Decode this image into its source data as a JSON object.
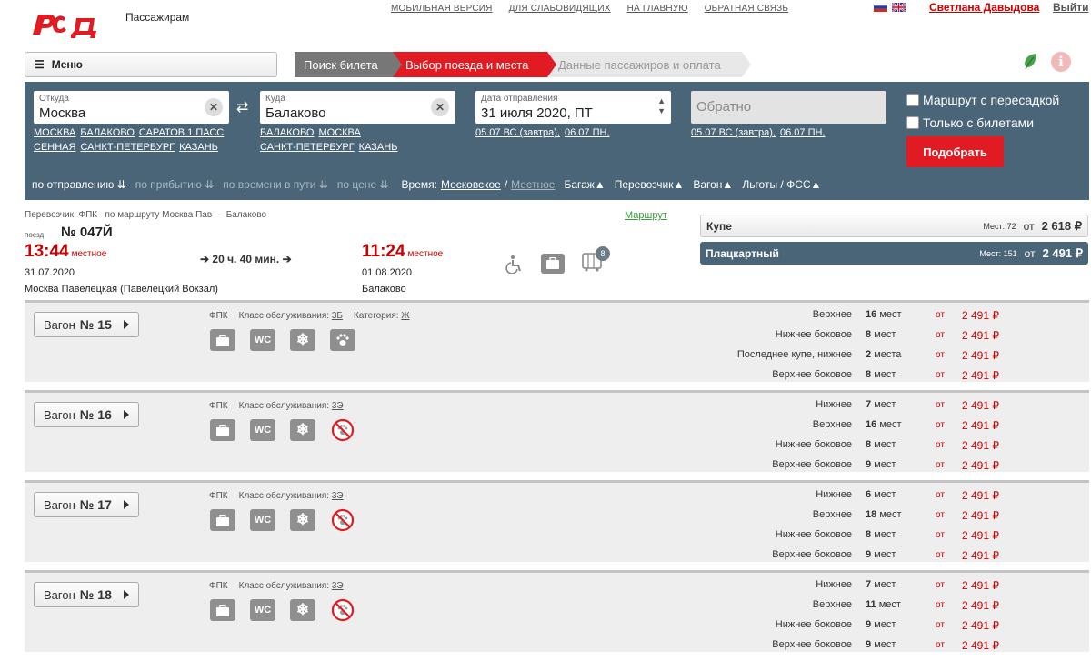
{
  "header": {
    "logo_alt": "РЖД",
    "subtitle": "Пассажирам",
    "links": [
      "МОБИЛЬНАЯ ВЕРСИЯ",
      "ДЛЯ СЛАБОВИДЯЩИХ",
      "НА ГЛАВНУЮ",
      "ОБРАТНАЯ СВЯЗЬ"
    ],
    "user": "Светлана Давыдова",
    "logout": "Выйти"
  },
  "menu": {
    "label": "Меню"
  },
  "steps": [
    "Поиск билета",
    "Выбор поезда и места",
    "Данные пассажиров и оплата"
  ],
  "search": {
    "from": {
      "label": "Откуда",
      "value": "Москва",
      "quick": [
        "МОСКВА",
        "БАЛАКОВО",
        "САРАТОВ 1 ПАСС",
        "СЕННАЯ",
        "САНКТ-ПЕТЕРБУРГ",
        "КАЗАНЬ"
      ]
    },
    "to": {
      "label": "Куда",
      "value": "Балаково",
      "quick": [
        "БАЛАКОВО",
        "МОСКВА",
        "САНКТ-ПЕТЕРБУРГ",
        "КАЗАНЬ"
      ]
    },
    "date": {
      "label": "Дата отправления",
      "value": "31 июля 2020, ПТ",
      "quick": [
        "05.07 ВС (завтра),",
        "06.07 ПН,"
      ]
    },
    "back": {
      "placeholder": "Обратно",
      "quick": [
        "05.07 ВС (завтра),",
        "06.07 ПН,"
      ]
    },
    "transfer_label": "Маршрут с пересадкой",
    "tickets_only_label": "Только с билетами",
    "find_button": "Подобрать"
  },
  "sort": {
    "by_departure": "по отправлению",
    "by_arrival": "по прибытию",
    "by_duration": "по времени в пути",
    "by_price": "по цене",
    "time_label": "Время:",
    "time_moscow": "Московское",
    "time_sep": "/",
    "time_local": "Местное",
    "baggage": "Багаж",
    "carrier": "Перевозчик",
    "car": "Вагон",
    "benefits": "Льготы / ФСС"
  },
  "train": {
    "carrier": "Перевозчик: ФПК",
    "route": "по маршруту Москва Пав — Балаково",
    "route_link": "Маршрут",
    "num_label": "поезд",
    "number": "№ 047Й",
    "dep_time": "13:44",
    "dep_type": "местное",
    "dep_date": "31.07.2020",
    "dep_station": "Москва Павелецкая (Павелецкий Вокзал)",
    "duration": "20 ч. 40 мин.",
    "arr_time": "11:24",
    "arr_type": "местное",
    "arr_date": "01.08.2020",
    "arr_station": "Балаково",
    "cars_badge": "8"
  },
  "classes": [
    {
      "name": "Купе",
      "seats": "Мест: 72",
      "from": "от",
      "price": "2 618 ₽"
    },
    {
      "name": "Плацкартный",
      "seats": "Мест: 151",
      "from": "от",
      "price": "2 491 ₽"
    }
  ],
  "cars": [
    {
      "label": "Вагон",
      "num": "№ 15",
      "carrier": "ФПК",
      "class_label": "Класс обслуживания:",
      "class": "3Б",
      "cat_label": "Категория:",
      "cat": "Ж",
      "pets": true,
      "seats": [
        {
          "type": "Верхнее",
          "count": "16",
          "unit": "мест",
          "from": "от",
          "price": "2 491 ₽"
        },
        {
          "type": "Нижнее боковое",
          "count": "8",
          "unit": "мест",
          "from": "от",
          "price": "2 491 ₽"
        },
        {
          "type": "Последнее купе, нижнее",
          "count": "2",
          "unit": "места",
          "from": "от",
          "price": "2 491 ₽"
        },
        {
          "type": "Верхнее боковое",
          "count": "8",
          "unit": "мест",
          "from": "от",
          "price": "2 491 ₽"
        }
      ]
    },
    {
      "label": "Вагон",
      "num": "№ 16",
      "carrier": "ФПК",
      "class_label": "Класс обслуживания:",
      "class": "3Э",
      "pets": false,
      "seats": [
        {
          "type": "Нижнее",
          "count": "7",
          "unit": "мест",
          "from": "от",
          "price": "2 491 ₽"
        },
        {
          "type": "Верхнее",
          "count": "16",
          "unit": "мест",
          "from": "от",
          "price": "2 491 ₽"
        },
        {
          "type": "Нижнее боковое",
          "count": "8",
          "unit": "мест",
          "from": "от",
          "price": "2 491 ₽"
        },
        {
          "type": "Верхнее боковое",
          "count": "9",
          "unit": "мест",
          "from": "от",
          "price": "2 491 ₽"
        }
      ]
    },
    {
      "label": "Вагон",
      "num": "№ 17",
      "carrier": "ФПК",
      "class_label": "Класс обслуживания:",
      "class": "3Э",
      "pets": false,
      "seats": [
        {
          "type": "Нижнее",
          "count": "6",
          "unit": "мест",
          "from": "от",
          "price": "2 491 ₽"
        },
        {
          "type": "Верхнее",
          "count": "18",
          "unit": "мест",
          "from": "от",
          "price": "2 491 ₽"
        },
        {
          "type": "Нижнее боковое",
          "count": "8",
          "unit": "мест",
          "from": "от",
          "price": "2 491 ₽"
        },
        {
          "type": "Верхнее боковое",
          "count": "9",
          "unit": "мест",
          "from": "от",
          "price": "2 491 ₽"
        }
      ]
    },
    {
      "label": "Вагон",
      "num": "№ 18",
      "carrier": "ФПК",
      "class_label": "Класс обслуживания:",
      "class": "3Э",
      "pets": false,
      "seats": [
        {
          "type": "Нижнее",
          "count": "7",
          "unit": "мест",
          "from": "от",
          "price": "2 491 ₽"
        },
        {
          "type": "Верхнее",
          "count": "11",
          "unit": "мест",
          "from": "от",
          "price": "2 491 ₽"
        },
        {
          "type": "Нижнее боковое",
          "count": "9",
          "unit": "мест",
          "from": "от",
          "price": "2 491 ₽"
        },
        {
          "type": "Верхнее боковое",
          "count": "9",
          "unit": "мест",
          "from": "от",
          "price": "2 491 ₽"
        }
      ]
    }
  ],
  "icons": {
    "baggage": "suitcase-icon",
    "wc": "wc-icon",
    "ac": "snowflake-icon",
    "pets": "paw-icon",
    "no_pets": "no-pets-icon",
    "accessible": "wheelchair-icon"
  },
  "colors": {
    "brand_red": "#e21b22",
    "panel": "#4a6478",
    "price_red": "#cc0000"
  }
}
